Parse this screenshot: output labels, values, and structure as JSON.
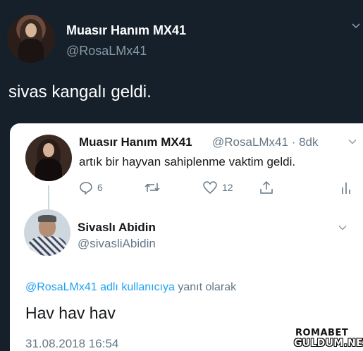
{
  "main_tweet": {
    "author_name": "Muasır Hanım MX41",
    "author_handle": "@RosaLMx41",
    "text": "sivas kangalı geldi."
  },
  "quoted_tweet": {
    "author_name": "Muasır Hanım MX41",
    "author_handle_time": "@RosaLMx41 · 8dk",
    "text": "artık bir hayvan sahiplenme vaktim geldi.",
    "reply_count": "6",
    "like_count": "12"
  },
  "reply_tweet": {
    "author_name": "Sivaslı Abidin",
    "author_handle": "@sivasliAbidin",
    "reply_to_mention": "@RosaLMx41",
    "reply_to_link": "adlı kullanıcıya",
    "reply_to_suffix": "yanıt olarak",
    "text": "Hav hav hav",
    "timestamp": "31.08.2018 16:54"
  },
  "watermark": {
    "line1": "ROMABET",
    "line2": "GULDUM.NET"
  },
  "colors": {
    "dark_bg": "#15202b",
    "link_blue": "#1da1f2",
    "muted_gray": "#657786"
  },
  "icons": [
    "chevron-down-icon",
    "reply-icon",
    "retweet-icon",
    "like-icon",
    "share-icon",
    "analytics-icon"
  ]
}
